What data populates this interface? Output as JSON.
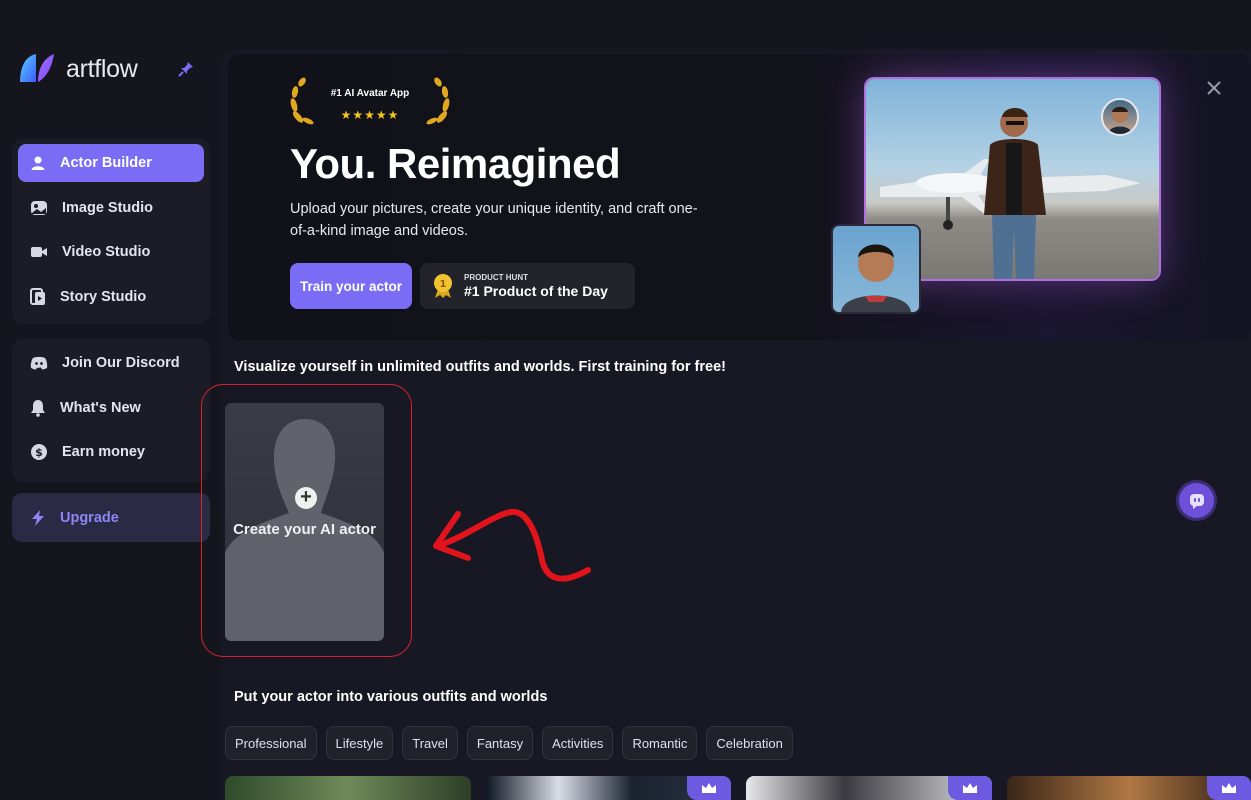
{
  "brand": {
    "name": "artflow"
  },
  "sidebar": {
    "primary": [
      {
        "label": "Actor Builder",
        "icon": "user-icon",
        "active": true
      },
      {
        "label": "Image Studio",
        "icon": "image-icon",
        "active": false
      },
      {
        "label": "Video Studio",
        "icon": "video-icon",
        "active": false
      },
      {
        "label": "Story Studio",
        "icon": "story-icon",
        "active": false
      }
    ],
    "secondary": [
      {
        "label": "Join Our Discord",
        "icon": "discord-icon"
      },
      {
        "label": "What's New",
        "icon": "bell-icon"
      },
      {
        "label": "Earn money",
        "icon": "dollar-icon"
      }
    ],
    "upgrade_label": "Upgrade"
  },
  "hero": {
    "badge": "#1 AI Avatar App",
    "stars": "★★★★★",
    "title": "You. Reimagined",
    "subtitle": "Upload your pictures, create your unique identity, and craft one-of-a-kind image and videos.",
    "train_button": "Train your actor",
    "product_hunt": {
      "small": "PRODUCT HUNT",
      "big": "#1 Product of the Day",
      "medal": "1"
    }
  },
  "section1": {
    "title": "Visualize yourself in unlimited outfits and worlds. First training for free!"
  },
  "create_card": {
    "label": "Create your AI actor"
  },
  "section2": {
    "title": "Put your actor into various outfits and worlds"
  },
  "categories": [
    "Professional",
    "Lifestyle",
    "Travel",
    "Fantasy",
    "Activities",
    "Romantic",
    "Celebration"
  ],
  "colors": {
    "accent": "#7b6cf6",
    "annotation_red": "#d8232a",
    "gold": "#f5c518"
  }
}
